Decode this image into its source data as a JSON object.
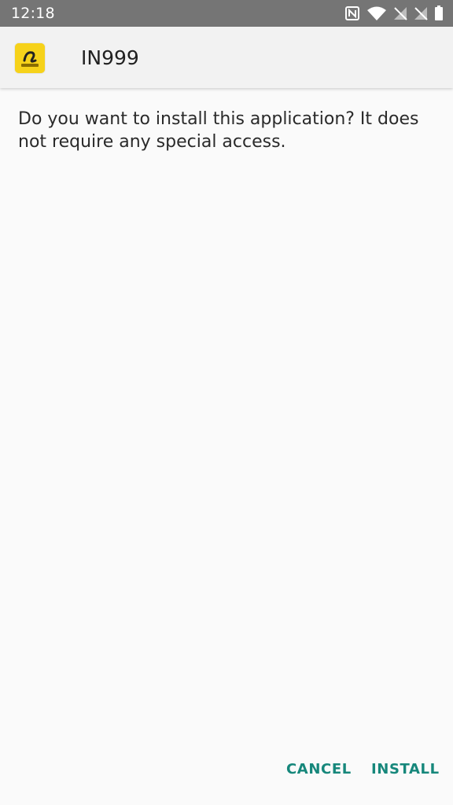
{
  "status_bar": {
    "time": "12:18",
    "icons": [
      "nfc-icon",
      "wifi-icon",
      "signal-off-icon",
      "signal-off-icon",
      "battery-icon"
    ]
  },
  "header": {
    "app_name": "IN999",
    "app_icon": "app-logo-icon",
    "app_icon_color": "#f6d21a"
  },
  "body": {
    "message": "Do you want to install this application? It does not require any special access."
  },
  "actions": {
    "cancel_label": "CANCEL",
    "install_label": "INSTALL",
    "accent_color": "#16877b"
  }
}
